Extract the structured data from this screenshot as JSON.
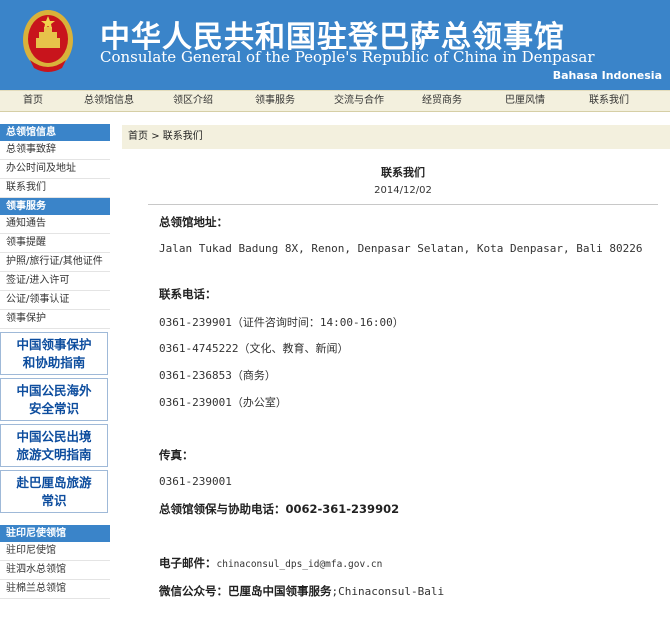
{
  "header": {
    "title_cn": "中华人民共和国驻登巴萨总领事馆",
    "title_en": "Consulate General of the People's Republic of China in Denpasar",
    "language_link": "Bahasa Indonesia",
    "emblem_icon": "national-emblem-icon",
    "bg_color": "#3a84c9"
  },
  "nav": {
    "items": [
      "首页",
      "总领馆信息",
      "领区介绍",
      "领事服务",
      "交流与合作",
      "经贸商务",
      "巴厘风情",
      "联系我们"
    ]
  },
  "sidebar": {
    "section1": {
      "title": "总领馆信息",
      "links": [
        "总领事致辞",
        "办公时间及地址",
        "联系我们"
      ]
    },
    "section2": {
      "title": "领事服务",
      "links": [
        "通知通告",
        "领事提醒",
        "护照/旅行证/其他证件",
        "签证/进入许可",
        "公证/领事认证",
        "领事保护"
      ]
    },
    "promos": [
      {
        "line1": "中国领事保护",
        "line2": "和协助指南"
      },
      {
        "line1": "中国公民海外",
        "line2": "安全常识"
      },
      {
        "line1": "中国公民出境",
        "line2": "旅游文明指南"
      },
      {
        "line1": "赴巴厘岛旅游",
        "line2": "常识"
      }
    ],
    "section3": {
      "title": "驻印尼使领馆",
      "links": [
        "驻印尼使馆",
        "驻泗水总领馆",
        "驻棉兰总领馆"
      ]
    }
  },
  "breadcrumb": {
    "home": "首页",
    "sep": ">",
    "current": "联系我们"
  },
  "article": {
    "title": "联系我们",
    "date": "2014/12/02",
    "address_label": "总领馆地址：",
    "address": "Jalan Tukad Badung 8X, Renon, Denpasar Selatan, Kota Denpasar, Bali 80226",
    "phone_label": "联系电话：",
    "phones": [
      "0361-239901（证件咨询时间：14:00-16:00）",
      "0361-4745222（文化、教育、新闻）",
      "0361-236853（商务）",
      "0361-239001（办公室）"
    ],
    "fax_label": "传真：",
    "fax": "0361-239001",
    "protection_label": "总领馆领保与协助电话：",
    "protection_phone": "0062-361-239902",
    "email_label": "电子邮件：",
    "email": "chinaconsul_dps_id@mfa.gov.cn",
    "wechat_label": "微信公众号：",
    "wechat_name": "巴厘岛中国领事服务",
    "wechat_id": ";Chinaconsul-Bali"
  }
}
